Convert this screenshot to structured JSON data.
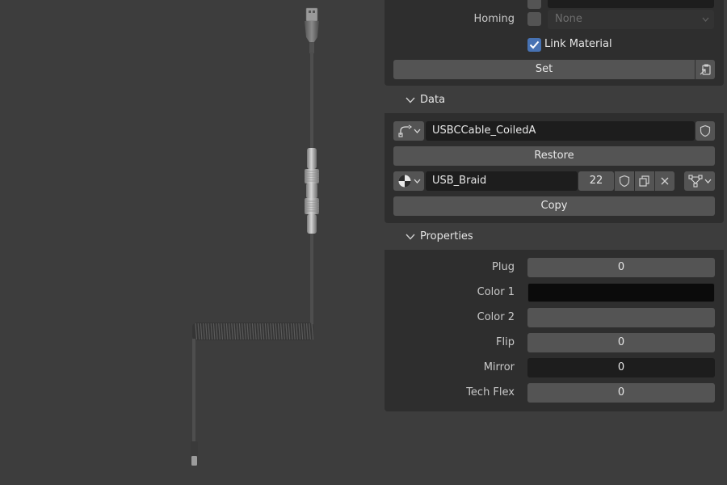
{
  "transform": {
    "homing_label": "Homing",
    "homing_value": "None",
    "link_material_label": "Link Material",
    "link_material_checked": true,
    "set_label": "Set"
  },
  "data_section": {
    "title": "Data",
    "object_name": "USBCCable_CoiledA",
    "restore_label": "Restore",
    "material_name": "USB_Braid",
    "material_users": "22",
    "copy_label": "Copy"
  },
  "properties_section": {
    "title": "Properties",
    "rows": [
      {
        "label": "Plug",
        "value": "0"
      },
      {
        "label": "Color 1",
        "value": ""
      },
      {
        "label": "Color 2",
        "value": ""
      },
      {
        "label": "Flip",
        "value": "0"
      },
      {
        "label": "Mirror",
        "value": "0"
      },
      {
        "label": "Tech Flex",
        "value": "0"
      }
    ]
  },
  "colors": {
    "accent": "#4772b3",
    "color1_swatch": "#0b0b0b",
    "color2_swatch": "#545454"
  },
  "icons": {
    "viewport": [
      "usb-a-connector",
      "aviator-connector",
      "coiled-cable",
      "usb-c-connector"
    ],
    "panel": [
      "chevron-down-icon",
      "curve-icon",
      "shield-icon",
      "material-ball-icon",
      "duplicate-icon",
      "close-icon",
      "node-tree-icon",
      "paste-icon",
      "checkmark-icon"
    ]
  }
}
